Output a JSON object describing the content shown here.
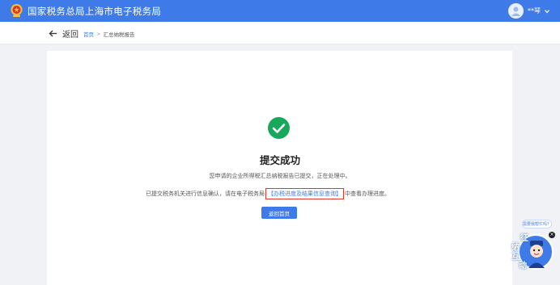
{
  "header": {
    "site_title": "国家税务总局上海市电子税务局",
    "user_name": "**琴"
  },
  "subnav": {
    "back_label": "返回",
    "breadcrumb_home": "首页",
    "breadcrumb_separator": ">",
    "breadcrumb_current": "汇总纳税报告"
  },
  "result": {
    "title": "提交成功",
    "message_line1": "您申请的企业所得税汇总纳税报告已提交，正在处理中。",
    "message_line2_prefix": "已提交税务机关进行信息确认，请在电子税务局",
    "message_line2_link": "【办税进度及结果信息查询】",
    "message_line2_suffix": "中查看办理进度。",
    "home_button_label": "返回首页"
  },
  "assistant": {
    "bubble_text": "需要我帮忙吗？",
    "chars": [
      "征",
      "纳",
      "互",
      "动"
    ],
    "close_symbol": "×"
  },
  "colors": {
    "brand_blue": "#3f7be8",
    "success_green": "#17a85b",
    "highlight_red": "#e2372b"
  },
  "icons": {
    "emblem": "tax-emblem-icon",
    "avatar": "user-avatar-icon",
    "dropdown": "chevron-down-icon",
    "back": "arrow-left-icon",
    "success": "check-circle-icon"
  }
}
